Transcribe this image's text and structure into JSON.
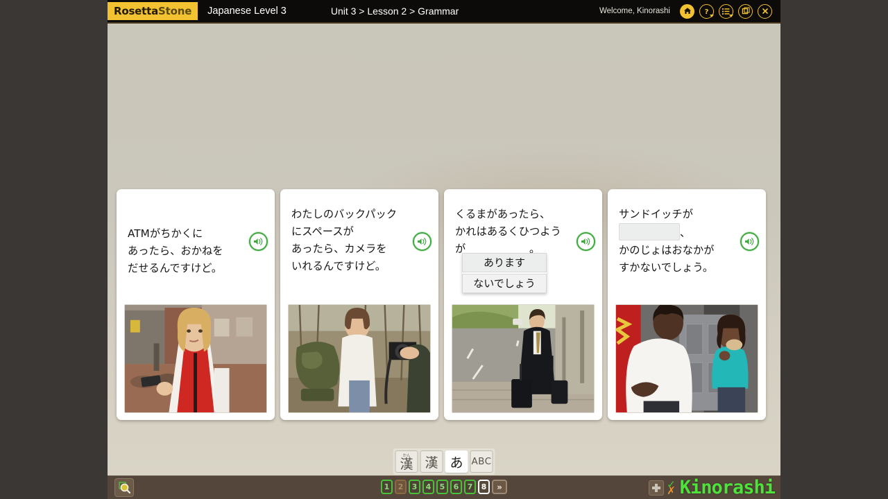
{
  "header": {
    "logo_a": "Rosetta",
    "logo_b": "Stone",
    "course_title": "Japanese Level 3",
    "breadcrumb": "Unit 3 > Lesson 2 > Grammar",
    "welcome": "Welcome, Kinorashi",
    "icons": [
      {
        "name": "home-icon",
        "label": "Home"
      },
      {
        "name": "help-icon",
        "label": "Help"
      },
      {
        "name": "menu-icon",
        "label": "Menu"
      },
      {
        "name": "window-icon",
        "label": "Window"
      },
      {
        "name": "close-icon",
        "label": "Close"
      }
    ]
  },
  "cards": [
    {
      "lines": [
        "ATMがちかくに",
        "あったら、おかねを",
        "だせるんですけど。"
      ],
      "speaker_label": "Play audio",
      "image_alt": "Woman in red vest on a brick street holding a card"
    },
    {
      "lines": [
        "わたしのバックパック",
        "にスペースが",
        "あったら、カメラを",
        "いれるんですけど。"
      ],
      "speaker_label": "Play audio",
      "image_alt": "Woman with green backpack handed a camera in the woods"
    },
    {
      "lines": [
        "くるまがあったら、",
        "かれはあるくひつよう",
        "が　　　　　　。"
      ],
      "speaker_label": "Play audio",
      "image_alt": "Businessman in black suit walking with luggage along a road",
      "dropdown": {
        "options": [
          "あります",
          "ないでしょう"
        ],
        "selected_index": 0
      }
    },
    {
      "lines_before": [
        "サンドイッチが"
      ],
      "blank_suffix": "、",
      "lines_after": [
        "かのじょはおなかが",
        "すかないでしょう。"
      ],
      "speaker_label": "Play audio",
      "image_alt": "Woman in white top holding stomach while girl in teal eats a sandwich"
    }
  ],
  "script_toggle": {
    "buttons": [
      {
        "name": "furigana-kanji-button",
        "ruby": "かん",
        "label": "漢",
        "active": false
      },
      {
        "name": "kanji-button",
        "ruby": "",
        "label": "漢",
        "active": false
      },
      {
        "name": "hiragana-button",
        "ruby": "",
        "label": "あ",
        "active": true
      },
      {
        "name": "romaji-button",
        "ruby": "",
        "label": "ABC",
        "active": false
      }
    ]
  },
  "footer": {
    "zoom_label": "Zoom",
    "pages": [
      {
        "label": "1",
        "state": "correct"
      },
      {
        "label": "2",
        "state": "wrong"
      },
      {
        "label": "3",
        "state": "correct"
      },
      {
        "label": "4",
        "state": "correct"
      },
      {
        "label": "5",
        "state": "correct"
      },
      {
        "label": "6",
        "state": "correct"
      },
      {
        "label": "7",
        "state": "correct"
      },
      {
        "label": "8",
        "state": "current"
      }
    ],
    "next_label": "»",
    "plus_label": "+",
    "check_mark": "✓",
    "x_mark": "✗",
    "watermark": "Kinorashi"
  },
  "colors": {
    "brand_yellow": "#f2c230",
    "header_black": "#0d0b09",
    "stage_beige": "#cbc7bb",
    "correct_green": "#49c23a",
    "wrong_brown": "#8a6a44",
    "speaker_green": "#3fa93f",
    "footer_brown": "#54463a",
    "watermark_green": "#4ee23c",
    "x_orange": "#e8952a"
  }
}
